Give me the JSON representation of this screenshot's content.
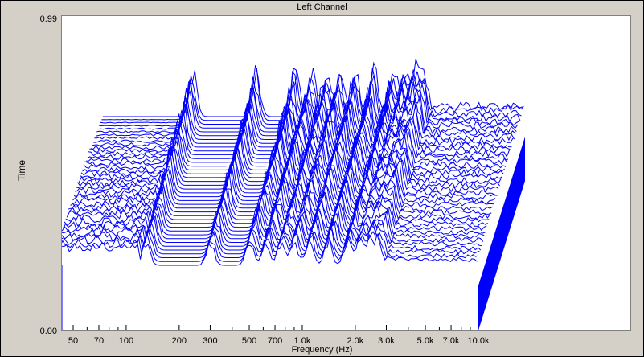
{
  "chart_data": {
    "type": "waterfall-3d-line",
    "title": "Left Channel",
    "xlabel": "Frequency (Hz)",
    "ylabel": "Time",
    "ylim": [
      0.0,
      0.99
    ],
    "ylim_labels": [
      "0.99",
      "0.00"
    ],
    "x_scale": "log",
    "xlim": [
      40,
      20000
    ],
    "x_ticks": [
      {
        "value": 50,
        "label": "50"
      },
      {
        "value": 70,
        "label": "70"
      },
      {
        "value": 100,
        "label": "100"
      },
      {
        "value": 200,
        "label": "200"
      },
      {
        "value": 300,
        "label": "300"
      },
      {
        "value": 500,
        "label": "500"
      },
      {
        "value": 700,
        "label": "700"
      },
      {
        "value": 1000,
        "label": "1.0k"
      },
      {
        "value": 2000,
        "label": "2.0k"
      },
      {
        "value": 3000,
        "label": "3.0k"
      },
      {
        "value": 5000,
        "label": "5.0k"
      },
      {
        "value": 7000,
        "label": "7.0k"
      },
      {
        "value": 10000,
        "label": "10.0k"
      }
    ],
    "x_minor_ticks": [
      40,
      60,
      80,
      90,
      400,
      600,
      800,
      900,
      4000,
      6000,
      8000,
      9000
    ],
    "freq_max": 10000,
    "series_color": "#0000ff",
    "slices": 40
  }
}
